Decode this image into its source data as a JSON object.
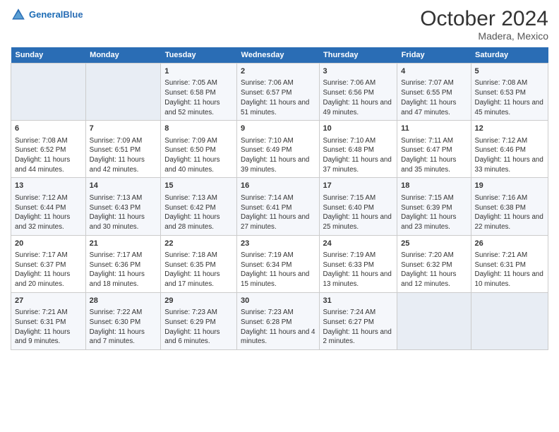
{
  "header": {
    "logo_line1": "General",
    "logo_line2": "Blue",
    "title": "October 2024",
    "subtitle": "Madera, Mexico"
  },
  "days_of_week": [
    "Sunday",
    "Monday",
    "Tuesday",
    "Wednesday",
    "Thursday",
    "Friday",
    "Saturday"
  ],
  "weeks": [
    [
      {
        "day": "",
        "info": ""
      },
      {
        "day": "",
        "info": ""
      },
      {
        "day": "1",
        "info": "Sunrise: 7:05 AM\nSunset: 6:58 PM\nDaylight: 11 hours and 52 minutes."
      },
      {
        "day": "2",
        "info": "Sunrise: 7:06 AM\nSunset: 6:57 PM\nDaylight: 11 hours and 51 minutes."
      },
      {
        "day": "3",
        "info": "Sunrise: 7:06 AM\nSunset: 6:56 PM\nDaylight: 11 hours and 49 minutes."
      },
      {
        "day": "4",
        "info": "Sunrise: 7:07 AM\nSunset: 6:55 PM\nDaylight: 11 hours and 47 minutes."
      },
      {
        "day": "5",
        "info": "Sunrise: 7:08 AM\nSunset: 6:53 PM\nDaylight: 11 hours and 45 minutes."
      }
    ],
    [
      {
        "day": "6",
        "info": "Sunrise: 7:08 AM\nSunset: 6:52 PM\nDaylight: 11 hours and 44 minutes."
      },
      {
        "day": "7",
        "info": "Sunrise: 7:09 AM\nSunset: 6:51 PM\nDaylight: 11 hours and 42 minutes."
      },
      {
        "day": "8",
        "info": "Sunrise: 7:09 AM\nSunset: 6:50 PM\nDaylight: 11 hours and 40 minutes."
      },
      {
        "day": "9",
        "info": "Sunrise: 7:10 AM\nSunset: 6:49 PM\nDaylight: 11 hours and 39 minutes."
      },
      {
        "day": "10",
        "info": "Sunrise: 7:10 AM\nSunset: 6:48 PM\nDaylight: 11 hours and 37 minutes."
      },
      {
        "day": "11",
        "info": "Sunrise: 7:11 AM\nSunset: 6:47 PM\nDaylight: 11 hours and 35 minutes."
      },
      {
        "day": "12",
        "info": "Sunrise: 7:12 AM\nSunset: 6:46 PM\nDaylight: 11 hours and 33 minutes."
      }
    ],
    [
      {
        "day": "13",
        "info": "Sunrise: 7:12 AM\nSunset: 6:44 PM\nDaylight: 11 hours and 32 minutes."
      },
      {
        "day": "14",
        "info": "Sunrise: 7:13 AM\nSunset: 6:43 PM\nDaylight: 11 hours and 30 minutes."
      },
      {
        "day": "15",
        "info": "Sunrise: 7:13 AM\nSunset: 6:42 PM\nDaylight: 11 hours and 28 minutes."
      },
      {
        "day": "16",
        "info": "Sunrise: 7:14 AM\nSunset: 6:41 PM\nDaylight: 11 hours and 27 minutes."
      },
      {
        "day": "17",
        "info": "Sunrise: 7:15 AM\nSunset: 6:40 PM\nDaylight: 11 hours and 25 minutes."
      },
      {
        "day": "18",
        "info": "Sunrise: 7:15 AM\nSunset: 6:39 PM\nDaylight: 11 hours and 23 minutes."
      },
      {
        "day": "19",
        "info": "Sunrise: 7:16 AM\nSunset: 6:38 PM\nDaylight: 11 hours and 22 minutes."
      }
    ],
    [
      {
        "day": "20",
        "info": "Sunrise: 7:17 AM\nSunset: 6:37 PM\nDaylight: 11 hours and 20 minutes."
      },
      {
        "day": "21",
        "info": "Sunrise: 7:17 AM\nSunset: 6:36 PM\nDaylight: 11 hours and 18 minutes."
      },
      {
        "day": "22",
        "info": "Sunrise: 7:18 AM\nSunset: 6:35 PM\nDaylight: 11 hours and 17 minutes."
      },
      {
        "day": "23",
        "info": "Sunrise: 7:19 AM\nSunset: 6:34 PM\nDaylight: 11 hours and 15 minutes."
      },
      {
        "day": "24",
        "info": "Sunrise: 7:19 AM\nSunset: 6:33 PM\nDaylight: 11 hours and 13 minutes."
      },
      {
        "day": "25",
        "info": "Sunrise: 7:20 AM\nSunset: 6:32 PM\nDaylight: 11 hours and 12 minutes."
      },
      {
        "day": "26",
        "info": "Sunrise: 7:21 AM\nSunset: 6:31 PM\nDaylight: 11 hours and 10 minutes."
      }
    ],
    [
      {
        "day": "27",
        "info": "Sunrise: 7:21 AM\nSunset: 6:31 PM\nDaylight: 11 hours and 9 minutes."
      },
      {
        "day": "28",
        "info": "Sunrise: 7:22 AM\nSunset: 6:30 PM\nDaylight: 11 hours and 7 minutes."
      },
      {
        "day": "29",
        "info": "Sunrise: 7:23 AM\nSunset: 6:29 PM\nDaylight: 11 hours and 6 minutes."
      },
      {
        "day": "30",
        "info": "Sunrise: 7:23 AM\nSunset: 6:28 PM\nDaylight: 11 hours and 4 minutes."
      },
      {
        "day": "31",
        "info": "Sunrise: 7:24 AM\nSunset: 6:27 PM\nDaylight: 11 hours and 2 minutes."
      },
      {
        "day": "",
        "info": ""
      },
      {
        "day": "",
        "info": ""
      }
    ]
  ]
}
